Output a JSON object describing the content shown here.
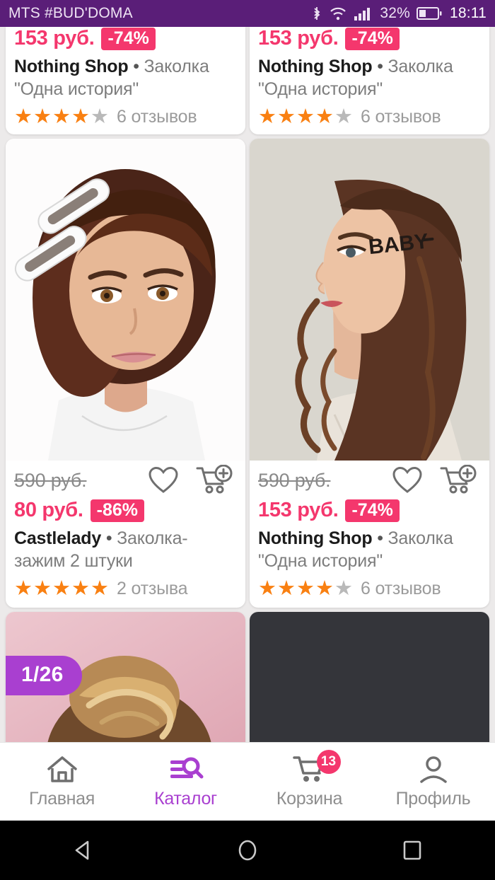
{
  "status_bar": {
    "carrier": "MTS #BUD'DOMA",
    "battery_percent": "32%",
    "time": "18:11",
    "icons": [
      "bluetooth-icon",
      "wifi-icon",
      "signal-icon",
      "battery-icon"
    ],
    "background_color": "#5a1e78"
  },
  "theme": {
    "accent_purple": "#a93fd0",
    "price_pink": "#f4376d",
    "star_orange": "#f98012",
    "muted_gray": "#8e8e8e"
  },
  "pager": {
    "label": "1/26"
  },
  "products": {
    "top_row": [
      {
        "price_new": "153 руб.",
        "discount": "-74%",
        "brand": "Nothing Shop",
        "separator": "•",
        "name": "Заколка \"Одна история\"",
        "stars_filled": 4,
        "stars_total": 5,
        "reviews": "6 отзывов"
      },
      {
        "price_new": "153 руб.",
        "discount": "-74%",
        "brand": "Nothing Shop",
        "separator": "•",
        "name": "Заколка \"Одна история\"",
        "stars_filled": 4,
        "stars_total": 5,
        "reviews": "6 отзывов"
      }
    ],
    "main_row": [
      {
        "price_old": "590 руб.",
        "price_new": "80 руб.",
        "discount": "-86%",
        "brand": "Castlelady",
        "separator": "•",
        "name": "Заколка-зажим 2 штуки",
        "stars_filled": 5,
        "stars_total": 5,
        "reviews": "2 отзыва",
        "image_alt": "woman-with-white-snap-hair-clips"
      },
      {
        "price_old": "590 руб.",
        "price_new": "153 руб.",
        "discount": "-74%",
        "brand": "Nothing Shop",
        "separator": "•",
        "name": "Заколка \"Одна история\"",
        "stars_filled": 4,
        "stars_total": 5,
        "reviews": "6 отзывов",
        "image_alt": "woman-profile-with-baby-hairpin"
      }
    ]
  },
  "tabbar": {
    "items": [
      {
        "label": "Главная",
        "icon": "home-icon",
        "active": false
      },
      {
        "label": "Каталог",
        "icon": "catalog-search-icon",
        "active": true
      },
      {
        "label": "Корзина",
        "icon": "cart-icon",
        "active": false,
        "badge": "13"
      },
      {
        "label": "Профиль",
        "icon": "person-icon",
        "active": false
      }
    ]
  },
  "android_nav": {
    "buttons": [
      "back-icon",
      "home-circle-icon",
      "recents-square-icon"
    ]
  }
}
